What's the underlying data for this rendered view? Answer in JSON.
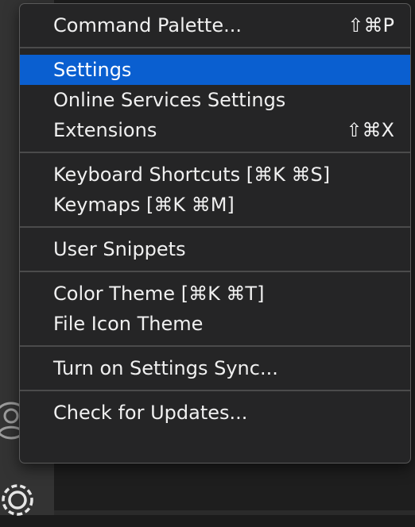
{
  "activity_bar": {
    "account_icon": "account-icon",
    "settings_icon": "gear-icon"
  },
  "menu": {
    "groups": [
      {
        "items": [
          {
            "label": "Command Palette...",
            "shortcut": "⇧⌘P"
          }
        ]
      },
      {
        "items": [
          {
            "label": "Settings",
            "shortcut": "",
            "selected": true
          },
          {
            "label": "Online Services Settings",
            "shortcut": ""
          },
          {
            "label": "Extensions",
            "shortcut": "⇧⌘X"
          }
        ]
      },
      {
        "items": [
          {
            "label": "Keyboard Shortcuts [⌘K ⌘S]",
            "shortcut": ""
          },
          {
            "label": "Keymaps [⌘K ⌘M]",
            "shortcut": ""
          }
        ]
      },
      {
        "items": [
          {
            "label": "User Snippets",
            "shortcut": ""
          }
        ]
      },
      {
        "items": [
          {
            "label": "Color Theme [⌘K ⌘T]",
            "shortcut": ""
          },
          {
            "label": "File Icon Theme",
            "shortcut": ""
          }
        ]
      },
      {
        "items": [
          {
            "label": "Turn on Settings Sync...",
            "shortcut": ""
          }
        ]
      },
      {
        "items": [
          {
            "label": "Check for Updates...",
            "shortcut": ""
          }
        ]
      }
    ]
  },
  "colors": {
    "selection": "#0a5fd0",
    "menu_background": "#252526",
    "activity_bar": "#333333"
  }
}
